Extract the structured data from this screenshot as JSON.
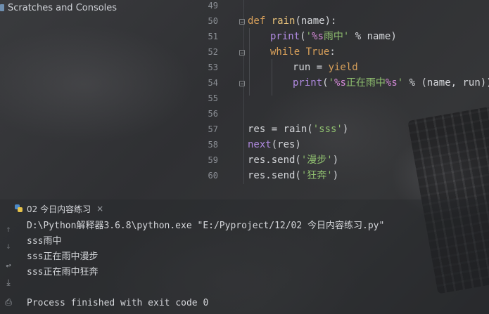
{
  "project": {
    "label": "Scratches and Consoles"
  },
  "editor": {
    "line_numbers": [
      "49",
      "50",
      "51",
      "52",
      "53",
      "54",
      "55",
      "56",
      "57",
      "58",
      "59",
      "60"
    ],
    "lines": {
      "l50": {
        "kw": "def",
        "name": "rain",
        "rest": "(name):"
      },
      "l51": {
        "builtin": "print",
        "open": "(",
        "str": "'",
        "fmt": "%s",
        "str2": "雨中'",
        "rest": " % name)"
      },
      "l52": {
        "kw": "while",
        "space": " ",
        "kw2": "True",
        "rest": ":"
      },
      "l53": {
        "pre": "run = ",
        "kw": "yield"
      },
      "l54": {
        "builtin": "print",
        "open": "(",
        "str": "'",
        "fmt": "%s",
        "str2": "正在雨中",
        "fmt2": "%s",
        "str3": "'",
        "rest": " % (name, run))"
      },
      "l57": {
        "pre": "res = rain(",
        "str": "'sss'",
        "rest": ")"
      },
      "l58": {
        "builtin": "next",
        "rest": "(res)"
      },
      "l59": {
        "pre": "res.send(",
        "str": "'漫步'",
        "rest": ")"
      },
      "l60": {
        "pre": "res.send(",
        "str": "'狂奔'",
        "rest": ")"
      }
    }
  },
  "run": {
    "tab_label": "02 今日内容练习",
    "tab_close": "×",
    "output": [
      "D:\\Python解释器3.6.8\\python.exe \"E:/Pyproject/12/02 今日内容练习.py\"",
      "sss雨中",
      "sss正在雨中漫步",
      "sss正在雨中狂奔",
      "",
      "Process finished with exit code 0"
    ]
  },
  "icons": {
    "up": "↑",
    "down": "↓",
    "wrap": "↩",
    "scroll_end": "⤓",
    "print": "⎙"
  }
}
